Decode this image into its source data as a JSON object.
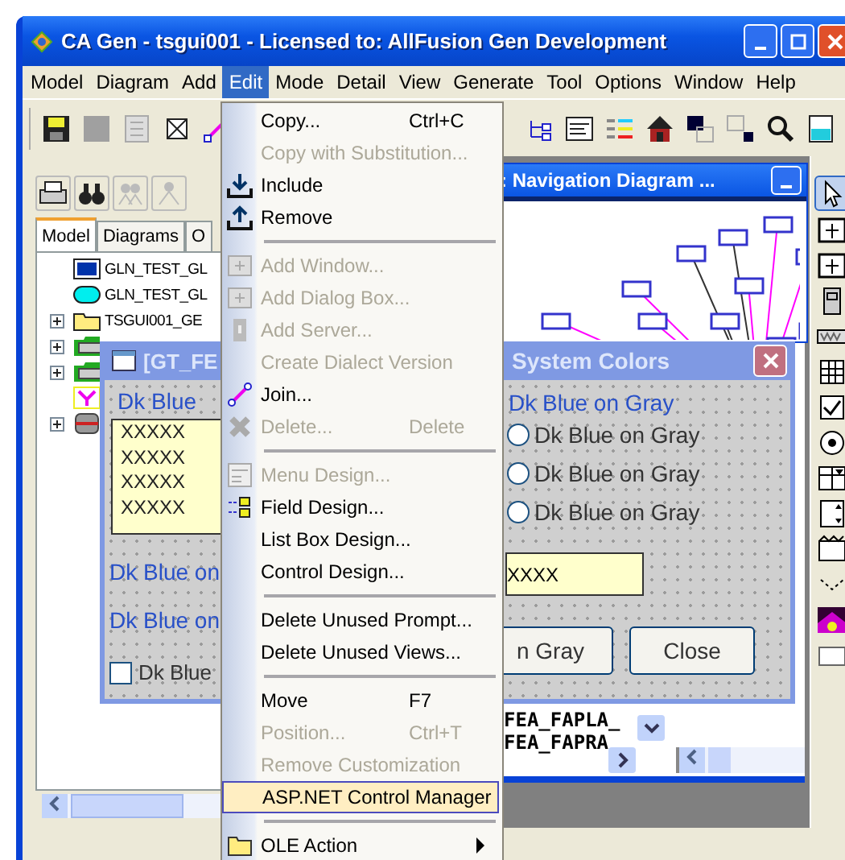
{
  "window": {
    "title": "CA Gen - tsgui001 - Licensed to:  AllFusion Gen Development"
  },
  "menu_bar": [
    {
      "label": "Model",
      "selected": false
    },
    {
      "label": "Diagram",
      "selected": false
    },
    {
      "label": "Add",
      "selected": false
    },
    {
      "label": "Edit",
      "selected": true
    },
    {
      "label": "Mode",
      "selected": false
    },
    {
      "label": "Detail",
      "selected": false
    },
    {
      "label": "View",
      "selected": false
    },
    {
      "label": "Generate",
      "selected": false
    },
    {
      "label": "Tool",
      "selected": false
    },
    {
      "label": "Options",
      "selected": false
    },
    {
      "label": "Window",
      "selected": false
    },
    {
      "label": "Help",
      "selected": false
    }
  ],
  "model_panel": {
    "tabs": [
      {
        "label": "Model",
        "selected": true
      },
      {
        "label": "Diagrams",
        "selected": false
      },
      {
        "label": "O",
        "selected": false
      }
    ],
    "tree": [
      {
        "label": "GLN_TEST_GL",
        "kind": "window"
      },
      {
        "label": "GLN_TEST_GL",
        "kind": "dialog"
      },
      {
        "label": "TSGUI001_GE",
        "kind": "folder"
      },
      {
        "kind": "server"
      },
      {
        "kind": "server"
      },
      {
        "kind": "flow"
      },
      {
        "kind": "database"
      }
    ]
  },
  "navigation_window": {
    "title": ":  Navigation Diagram ..."
  },
  "back_window": {
    "rows": [
      "FEA_FAPLA_",
      "FEA_FAPRA"
    ]
  },
  "dialog": {
    "title_left": "[GT_FE",
    "title_right": "System Colors",
    "label": "Dk Blue",
    "list_items": [
      "XXXXX",
      "XXXXX",
      "XXXXX",
      "XXXXX"
    ],
    "left_labels": [
      "Dk Blue on",
      "Dk Blue on"
    ],
    "checkbox": {
      "label": "Dk Blue",
      "checked": false
    },
    "right_header": "Dk Blue on Gray",
    "radios": [
      {
        "label": "Dk Blue on Gray",
        "selected": false
      },
      {
        "label": "Dk Blue on Gray",
        "selected": false
      },
      {
        "label": "Dk Blue on Gray",
        "selected": false
      }
    ],
    "field_value": "XXXX",
    "buttons": [
      "n Gray",
      "Close"
    ]
  },
  "edit_menu": [
    {
      "kind": "item",
      "label": "Copy...",
      "shortcut": "Ctrl+C",
      "disabled": false,
      "selected": false
    },
    {
      "kind": "item",
      "label": "Copy with Substitution...",
      "disabled": true,
      "selected": false
    },
    {
      "kind": "item",
      "label": "Include",
      "disabled": false,
      "selected": false
    },
    {
      "kind": "item",
      "label": "Remove",
      "disabled": false,
      "selected": false
    },
    {
      "kind": "separator"
    },
    {
      "kind": "item",
      "label": "Add Window...",
      "disabled": true,
      "selected": false
    },
    {
      "kind": "item",
      "label": "Add Dialog Box...",
      "disabled": true,
      "selected": false
    },
    {
      "kind": "item",
      "label": "Add Server...",
      "disabled": true,
      "selected": false
    },
    {
      "kind": "item",
      "label": "Create Dialect Version",
      "disabled": true,
      "selected": false
    },
    {
      "kind": "item",
      "label": "Join...",
      "disabled": false,
      "selected": false
    },
    {
      "kind": "item",
      "label": "Delete...",
      "shortcut": "Delete",
      "disabled": true,
      "selected": false
    },
    {
      "kind": "separator"
    },
    {
      "kind": "item",
      "label": "Menu Design...",
      "disabled": true,
      "selected": false
    },
    {
      "kind": "item",
      "label": "Field Design...",
      "disabled": false,
      "selected": false
    },
    {
      "kind": "item",
      "label": "List Box Design...",
      "disabled": false,
      "selected": false
    },
    {
      "kind": "item",
      "label": "Control Design...",
      "disabled": false,
      "selected": false
    },
    {
      "kind": "separator"
    },
    {
      "kind": "item",
      "label": "Delete Unused Prompt...",
      "disabled": false,
      "selected": false
    },
    {
      "kind": "item",
      "label": "Delete Unused Views...",
      "disabled": false,
      "selected": false
    },
    {
      "kind": "separator"
    },
    {
      "kind": "item",
      "label": "Move",
      "shortcut": "F7",
      "disabled": false,
      "selected": false
    },
    {
      "kind": "item",
      "label": "Position...",
      "shortcut": "Ctrl+T",
      "disabled": true,
      "selected": false
    },
    {
      "kind": "item",
      "label": "Remove Customization",
      "disabled": true,
      "selected": false
    },
    {
      "kind": "item",
      "label": "ASP.NET Control Manager",
      "disabled": false,
      "selected": true
    },
    {
      "kind": "separator"
    },
    {
      "kind": "submenu",
      "label": "OLE Action",
      "disabled": false,
      "selected": false
    }
  ]
}
